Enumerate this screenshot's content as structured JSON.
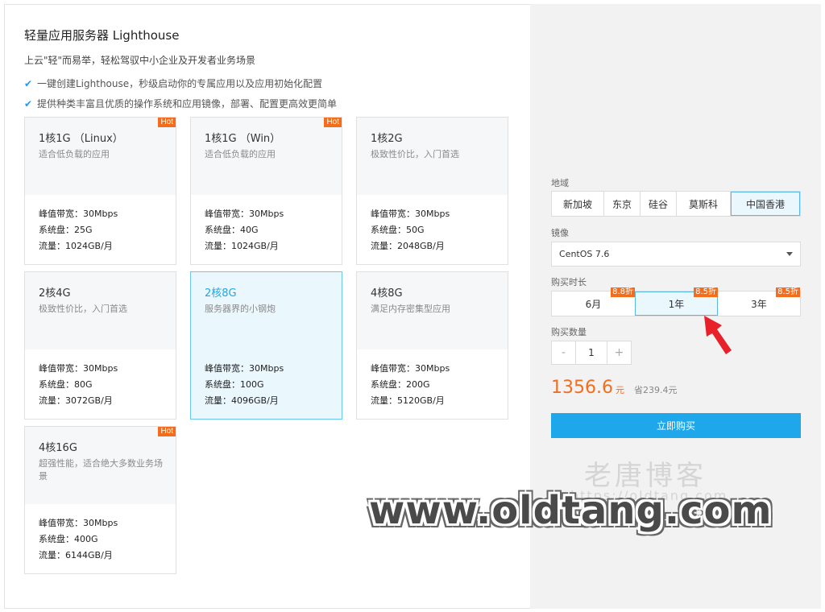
{
  "header": {
    "title": "轻量应用服务器 Lighthouse",
    "subtitle": "上云\"轻\"而易举，轻松驾驭中小企业及开发者业务场景",
    "features": [
      "一键创建Lighthouse，秒级启动你的专属应用以及应用初始化配置",
      "提供种类丰富且优质的操作系统和应用镜像，部署、配置更高效更简单"
    ]
  },
  "plans": [
    {
      "name": "1核1G （Linux）",
      "desc": "适合低负载的应用",
      "bandwidth": "峰值带宽：30Mbps",
      "disk": "系统盘：25G",
      "traffic": "流量：1024GB/月",
      "badge": "Hot",
      "selected": false
    },
    {
      "name": "1核1G （Win）",
      "desc": "适合低负载的应用",
      "bandwidth": "峰值带宽：30Mbps",
      "disk": "系统盘：40G",
      "traffic": "流量：1024GB/月",
      "badge": "Hot",
      "selected": false
    },
    {
      "name": "1核2G",
      "desc": "极致性价比，入门首选",
      "bandwidth": "峰值带宽：30Mbps",
      "disk": "系统盘：50G",
      "traffic": "流量：2048GB/月",
      "badge": "",
      "selected": false
    },
    {
      "name": "2核4G",
      "desc": "极致性价比，入门首选",
      "bandwidth": "峰值带宽：30Mbps",
      "disk": "系统盘：80G",
      "traffic": "流量：3072GB/月",
      "badge": "",
      "selected": false
    },
    {
      "name": "2核8G",
      "desc": "服务器界的小钢炮",
      "bandwidth": "峰值带宽：30Mbps",
      "disk": "系统盘：100G",
      "traffic": "流量：4096GB/月",
      "badge": "",
      "selected": true
    },
    {
      "name": "4核8G",
      "desc": "满足内存密集型应用",
      "bandwidth": "峰值带宽：30Mbps",
      "disk": "系统盘：200G",
      "traffic": "流量：5120GB/月",
      "badge": "",
      "selected": false
    },
    {
      "name": "4核16G",
      "desc": "超强性能，适合绝大多数业务场景",
      "bandwidth": "峰值带宽：30Mbps",
      "disk": "系统盘：400G",
      "traffic": "流量：6144GB/月",
      "badge": "Hot",
      "selected": false
    }
  ],
  "order": {
    "region_label": "地域",
    "regions": [
      "新加坡",
      "东京",
      "硅谷",
      "莫斯科",
      "中国香港"
    ],
    "selected_region": "中国香港",
    "image_label": "镜像",
    "image_value": "CentOS 7.6",
    "duration_label": "购买时长",
    "durations": [
      {
        "label": "6月",
        "discount": "8.8折"
      },
      {
        "label": "1年",
        "discount": "8.5折"
      },
      {
        "label": "3年",
        "discount": "8.5折"
      }
    ],
    "selected_duration": "1年",
    "quantity_label": "购买数量",
    "quantity": "1",
    "minus": "-",
    "plus": "+",
    "price": "1356.6",
    "price_unit": "元",
    "savings": "省239.4元",
    "buy_label": "立即购买"
  },
  "watermark": {
    "cn": "老唐博客",
    "url": "https://oldtang.com",
    "big": "www.oldtang.com"
  },
  "colors": {
    "accent": "#1ea7ea",
    "hot_badge": "#f36d1d",
    "selected_bg": "#eaf7fd",
    "arrow": "#e8202a"
  }
}
